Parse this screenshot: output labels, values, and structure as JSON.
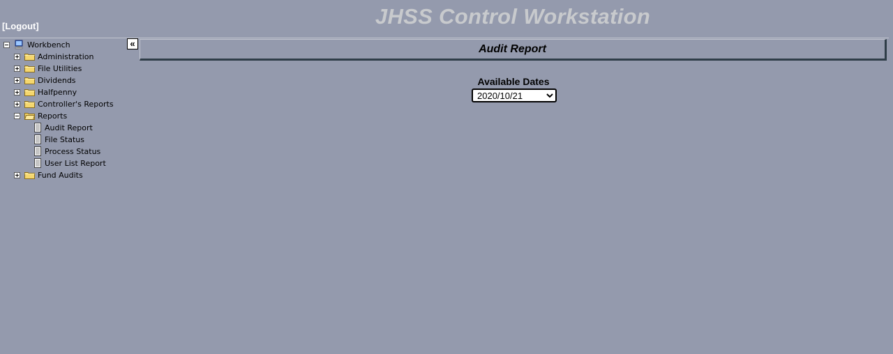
{
  "header": {
    "logout_label": "[Logout]",
    "app_title": "JHSS Control Workstation"
  },
  "sidebar": {
    "collapse_label": "«",
    "root": {
      "label": "Workbench",
      "icon": "computer-icon",
      "expanded": true
    },
    "items": [
      {
        "label": "Administration",
        "icon": "folder-icon",
        "expanded": false
      },
      {
        "label": "File Utilities",
        "icon": "folder-icon",
        "expanded": false
      },
      {
        "label": "Dividends",
        "icon": "folder-icon",
        "expanded": false
      },
      {
        "label": "Halfpenny",
        "icon": "folder-icon",
        "expanded": false
      },
      {
        "label": "Controller's Reports",
        "icon": "folder-icon",
        "expanded": false
      },
      {
        "label": "Reports",
        "icon": "folder-icon",
        "expanded": true,
        "children": [
          {
            "label": "Audit Report",
            "icon": "document-icon"
          },
          {
            "label": "File Status",
            "icon": "document-icon"
          },
          {
            "label": "Process Status",
            "icon": "document-icon"
          },
          {
            "label": "User List Report",
            "icon": "document-icon"
          }
        ]
      },
      {
        "label": "Fund Audits",
        "icon": "folder-icon",
        "expanded": false
      }
    ]
  },
  "main": {
    "report_title": "Audit Report",
    "dates_label": "Available Dates",
    "date_select": {
      "selected": "2020/10/21",
      "options": [
        "2020/10/21"
      ]
    }
  },
  "colors": {
    "background": "#949aad",
    "title_text": "#c8cacd",
    "header_shadow": "#2f3d48"
  }
}
